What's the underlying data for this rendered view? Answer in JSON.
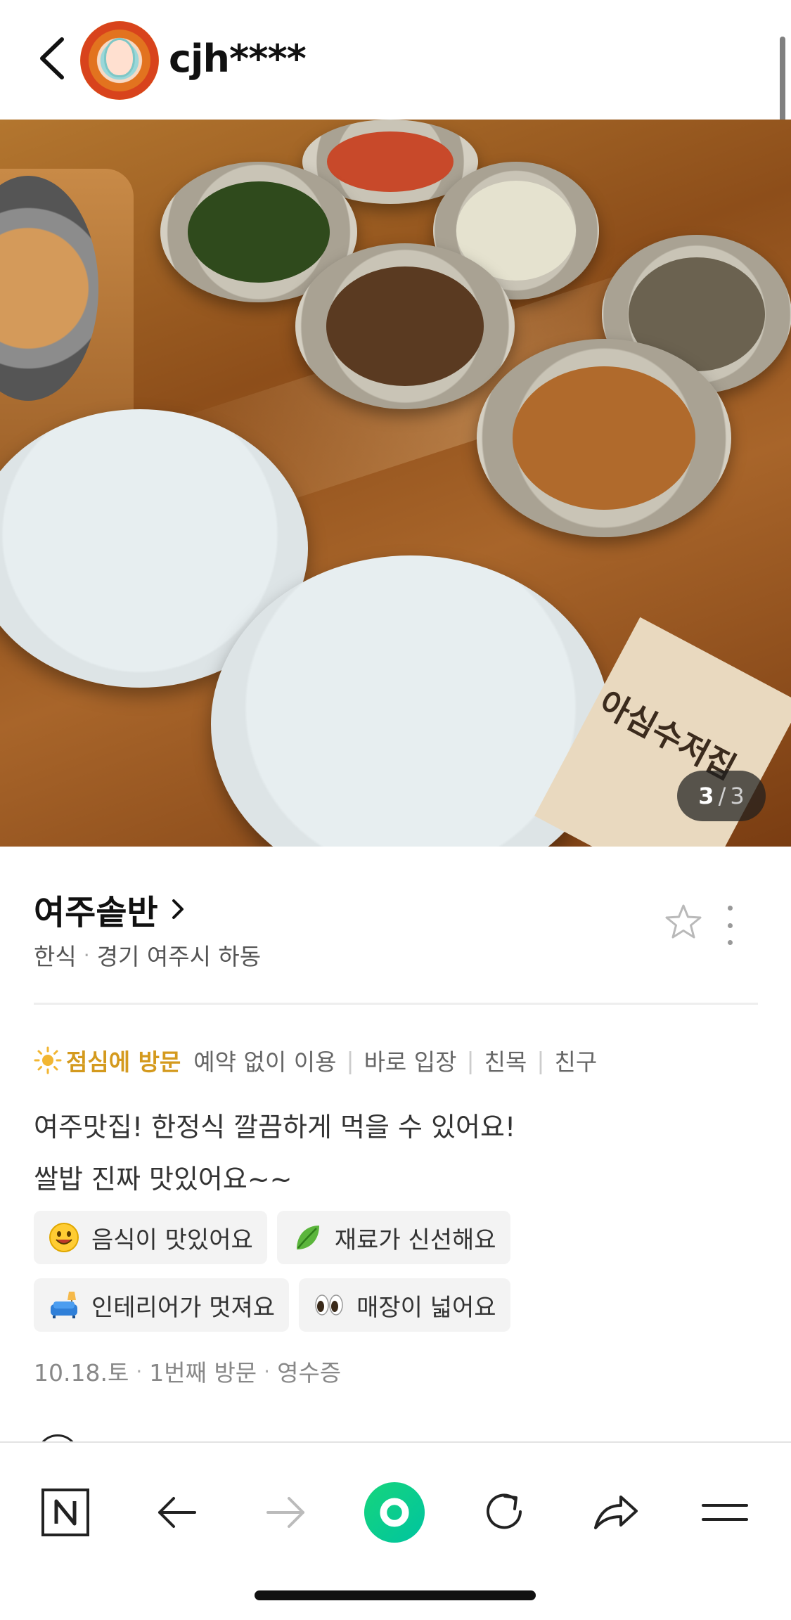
{
  "header": {
    "username": "cjh****"
  },
  "photo": {
    "current": "3",
    "separator": "/",
    "total": "3",
    "wrapper_text": "아심수저집"
  },
  "place": {
    "name": "여주솥반",
    "category": "한식",
    "location": "경기 여주시 하동"
  },
  "visit": {
    "time_label": "점심에 방문",
    "tags": [
      "예약 없이 이용",
      "바로 입장",
      "친목",
      "친구"
    ]
  },
  "review": {
    "line1": "여주맛집! 한정식 깔끔하게 먹을 수 있어요!",
    "line2": "쌀밥 진짜 맛있어요~~"
  },
  "keywords": [
    {
      "icon": "smiley-icon",
      "label": "음식이 맛있어요"
    },
    {
      "icon": "leaf-icon",
      "label": "재료가 신선해요"
    },
    {
      "icon": "sofa-icon",
      "label": "인테리어가 멋져요"
    },
    {
      "icon": "eyes-icon",
      "label": "매장이 넓어요"
    }
  ],
  "visit_info": {
    "date": "10.18.토",
    "visit_count": "1번째 방문",
    "proof": "영수증"
  },
  "colors": {
    "accent_visit": "#d49a1e",
    "green_button": "#03c75a"
  }
}
